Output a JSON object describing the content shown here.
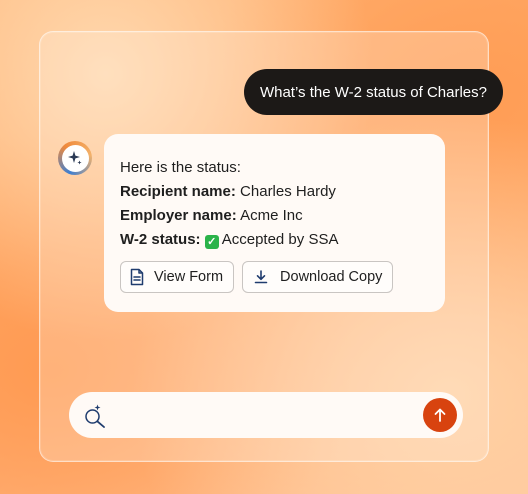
{
  "chat": {
    "user_message": "What’s the W-2 status of Charles?",
    "bot": {
      "intro": "Here is the status:",
      "recipient_label": "Recipient name:",
      "recipient_value": "Charles Hardy",
      "employer_label": "Employer name:",
      "employer_value": "Acme Inc",
      "w2_label": "W-2 status:",
      "w2_check": "✓",
      "w2_value": "Accepted by SSA",
      "buttons": {
        "view_form": "View Form",
        "download_copy": "Download Copy"
      }
    }
  },
  "composer": {
    "placeholder": "",
    "value": ""
  },
  "icons": {
    "avatar": "sparkle-icon",
    "view_form": "document-icon",
    "download": "download-icon",
    "composer": "magic-search-icon",
    "send": "arrow-up-icon"
  },
  "colors": {
    "user_bubble": "#1c1917",
    "send_button": "#d8430f",
    "check": "#2bb34a"
  }
}
